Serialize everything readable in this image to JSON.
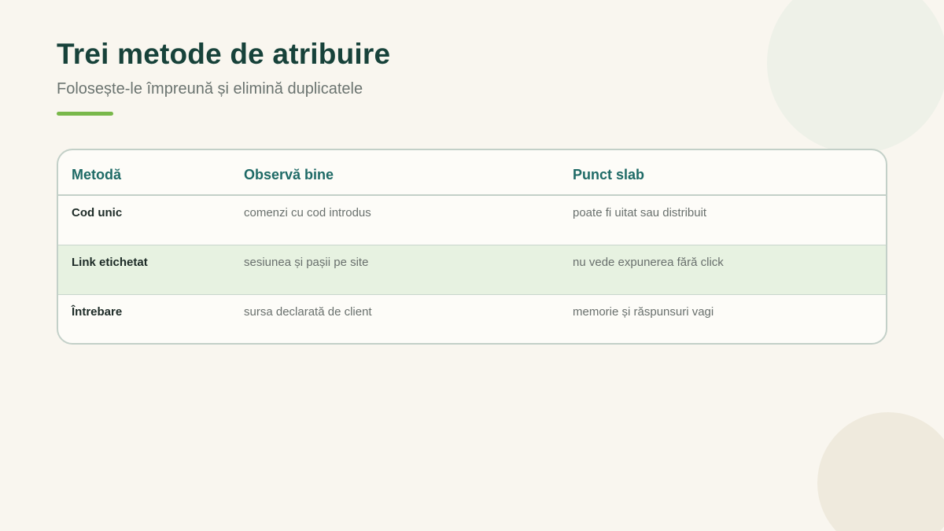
{
  "slide": {
    "title": "Trei metode de atribuire",
    "subtitle": "Folosește-le împreună și elimină duplicatele"
  },
  "table": {
    "headers": [
      "Metodă",
      "Observă bine",
      "Punct slab"
    ],
    "rows": [
      [
        "Cod unic",
        "comenzi cu cod introdus",
        "poate fi uitat sau distribuit"
      ],
      [
        "Link etichetat",
        "sesiunea și pașii pe site",
        "nu vede expunerea fără click"
      ],
      [
        "Întrebare",
        "sursa declarată de client",
        "memorie și răspunsuri vagi"
      ]
    ],
    "highlighted_row": 1
  },
  "colors": {
    "background": "#f9f6ef",
    "title": "#17423a",
    "accent": "#79b84a",
    "header_text": "#1e6a66",
    "highlight_row": "#e7f2e1",
    "border": "#c3d0c8"
  }
}
